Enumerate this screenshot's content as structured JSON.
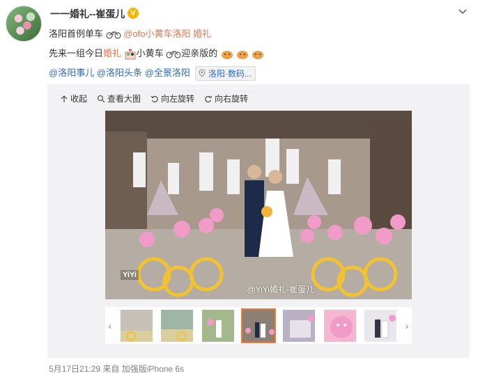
{
  "post": {
    "username": "一一婚礼--崔蛋儿",
    "verified_badge": "V",
    "line1_prefix": "洛阳首例单车",
    "line1_mention": "@ofo小黄车洛阳",
    "line1_tag": "婚礼",
    "line2_prefix": "先来一组今日",
    "line2_tag": "婚礼",
    "line2_mid": "小黄车",
    "line2_suffix": "迎亲版的",
    "topics": [
      "@洛阳事儿",
      "@洛阳头条",
      "@全景洛阳"
    ],
    "location_label": "洛阳·数码..."
  },
  "toolbar": {
    "collapse_label": "收起",
    "view_large_label": "查看大图",
    "rotate_left_label": "向左旋转",
    "rotate_right_label": "向右旋转"
  },
  "photo": {
    "watermark": "@YiYi婚礼-崔蛋儿",
    "logo": "YiYi"
  },
  "thumbnails": {
    "count": 7,
    "active_index": 3,
    "prev_icon": "chevron-left-icon",
    "next_icon": "chevron-right-icon"
  },
  "footer": {
    "timestamp": "5月17日21:29 来自 加强版iPhone 6s"
  },
  "colors": {
    "link_orange": "#eb7350",
    "link_blue": "#2f6ac7",
    "badge_gold": "#f7b500",
    "active_thumb": "#f07a36"
  }
}
